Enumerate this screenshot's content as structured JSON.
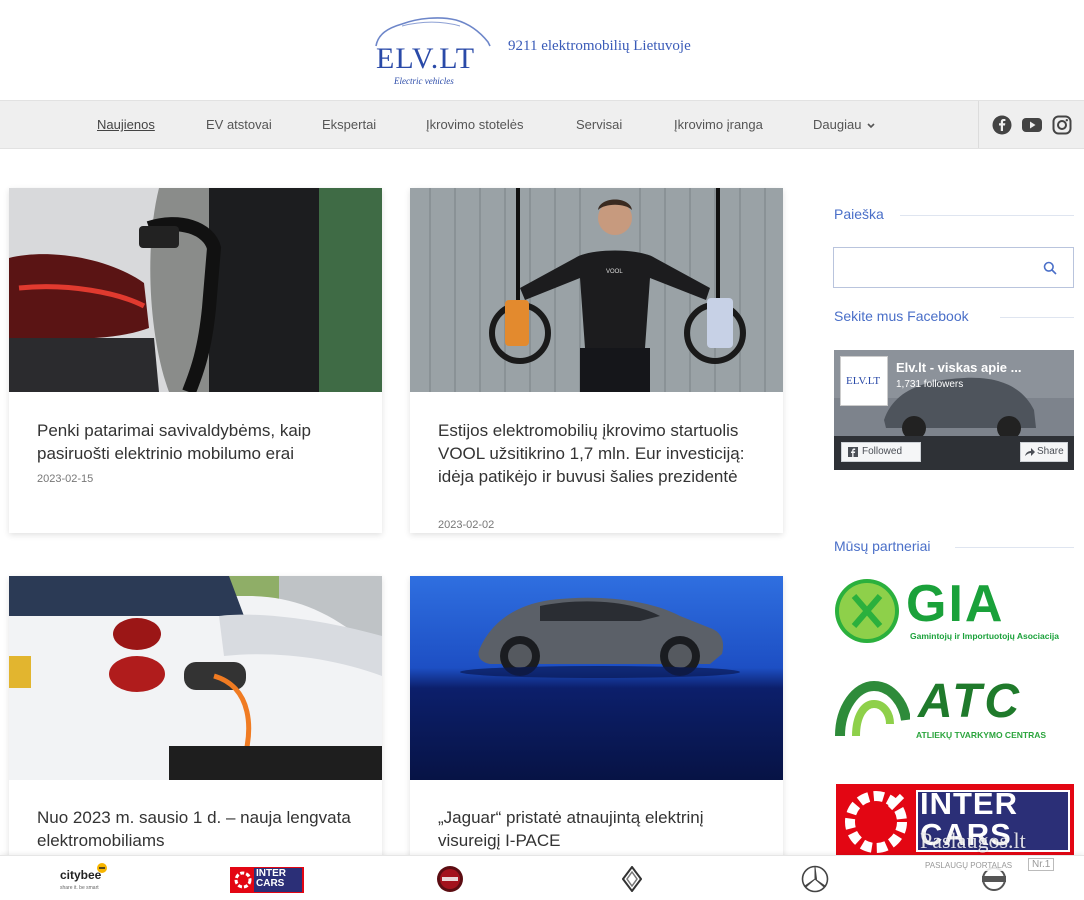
{
  "header": {
    "logo_text": "ELV.LT",
    "logo_sub": "Electric vehicles",
    "tagline": "9211 elektromobilių Lietuvoje"
  },
  "nav": {
    "items": [
      {
        "label": "Naujienos",
        "active": true
      },
      {
        "label": "EV atstovai"
      },
      {
        "label": "Ekspertai"
      },
      {
        "label": "Įkrovimo stotelės"
      },
      {
        "label": "Servisai"
      },
      {
        "label": "Įkrovimo įranga"
      },
      {
        "label": "Daugiau"
      }
    ],
    "social": [
      "facebook-icon",
      "youtube-icon",
      "instagram-icon"
    ]
  },
  "articles": [
    {
      "title": "Penki patarimai savivaldybėms, kaip pasiruošti elektrinio mobilumo erai",
      "date": "2023-02-15"
    },
    {
      "title": "Estijos elektromobilių įkrovimo startuolis VOOL užsitikrino 1,7 mln. Eur investiciją: idėja patikėjo ir buvusi šalies prezidentė",
      "date": "2023-02-02",
      "image_text": "VOOL"
    },
    {
      "title": "Nuo 2023 m. sausio 1 d. – nauja lengvata elektromobiliams"
    },
    {
      "title": "„Jaguar“ pristatė atnaujintą elektrinį visureigį I-PACE"
    }
  ],
  "sidebar": {
    "search_label": "Paieška",
    "search_placeholder": "",
    "facebook_label": "Sekite mus Facebook",
    "fb_widget": {
      "page_name": "Elv.lt - viskas apie ...",
      "followers": "1,731 followers",
      "followed_button": "Followed",
      "share_button": "Share",
      "logo_text": "ELV.LT"
    },
    "partners_label": "Mūsų partneriai",
    "partners": [
      {
        "name": "GIA",
        "subtitle": "Gamintojų ir Importuotojų Asociacija",
        "color": "#1aa13a"
      },
      {
        "name": "ATC",
        "subtitle": "ATLIEKŲ TVARKYMO CENTRAS",
        "color": "#1f7a2b"
      },
      {
        "name": "INTER CARS",
        "color": "#e30613"
      }
    ]
  },
  "footer": {
    "partners": [
      {
        "name": "citybee",
        "sub": "share it. be smart"
      },
      {
        "name": "INTER CARS"
      },
      {
        "name": "fiat-icon"
      },
      {
        "name": "renault-icon"
      },
      {
        "name": "mercedes-icon"
      },
      {
        "name": "nissan-icon"
      }
    ]
  },
  "watermark": {
    "line1": "Paslaugos.lt",
    "line2": "PASLAUGŲ PORTALAS",
    "badge": "Nr.1"
  },
  "colors": {
    "accent": "#4a6fc8",
    "logo": "#2a4aa8",
    "nav_bg": "#efefef"
  }
}
